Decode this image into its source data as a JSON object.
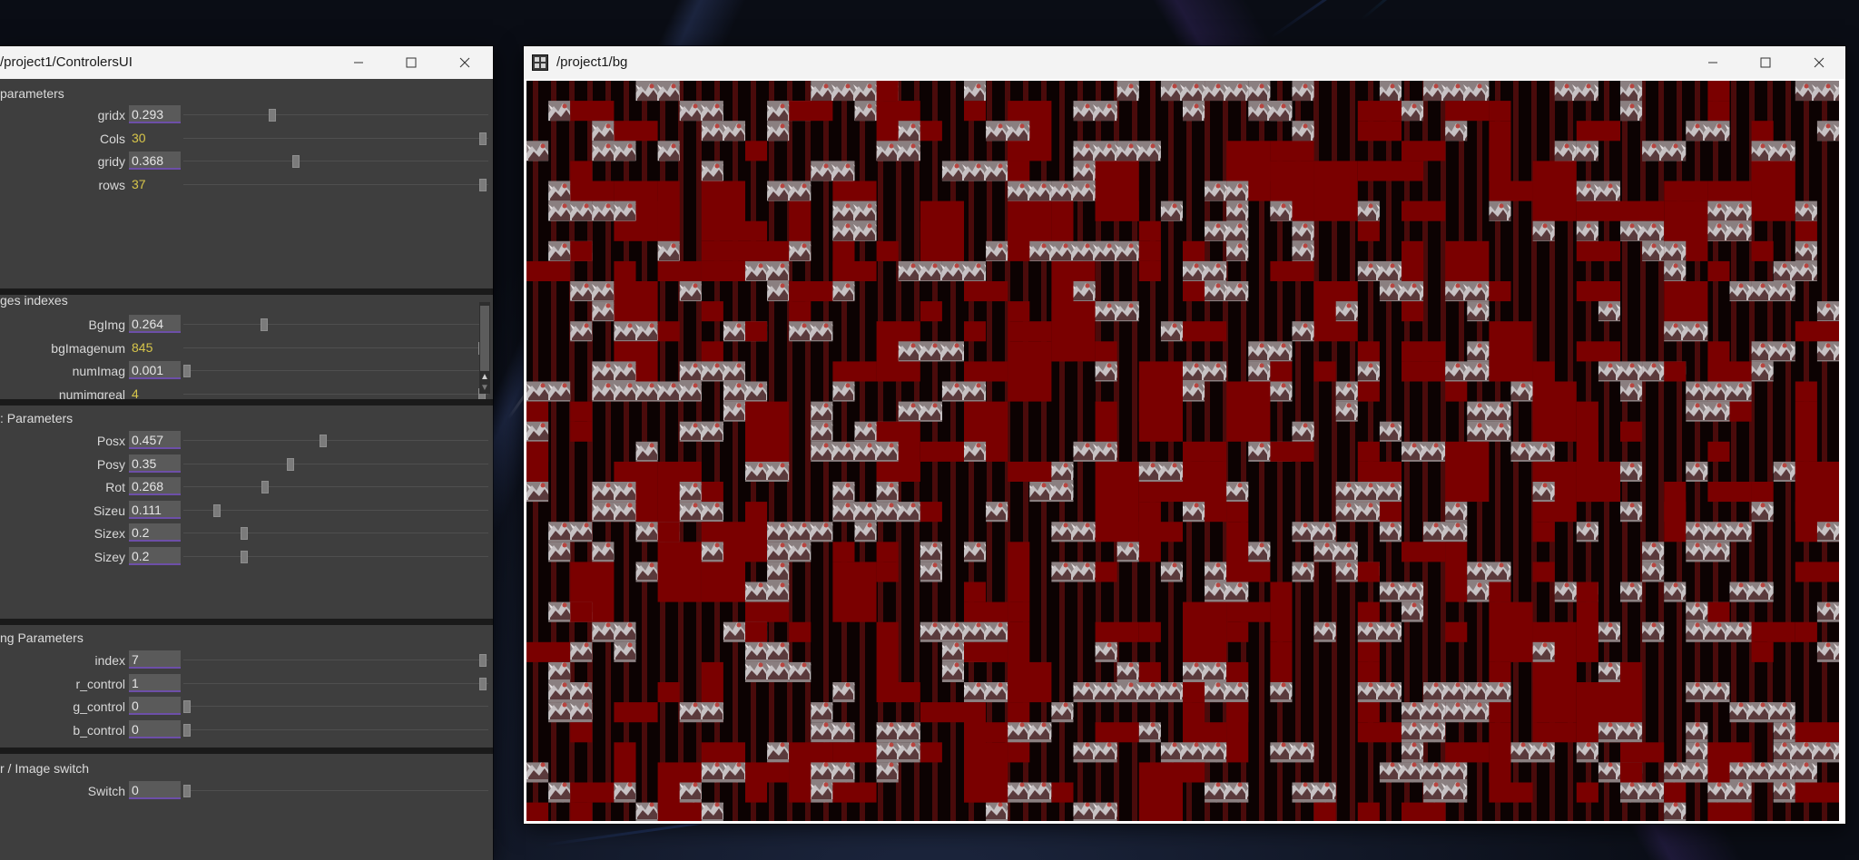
{
  "controllers_window": {
    "title": "/project1/ControlersUI",
    "sections": [
      {
        "title": "parameters",
        "rows": [
          {
            "label": "gridx",
            "value": "0.293",
            "style": "box",
            "level": 0.293
          },
          {
            "label": "Cols",
            "value": "30",
            "style": "yellow",
            "level": 1.0
          },
          {
            "label": "gridy",
            "value": "0.368",
            "style": "box",
            "level": 0.368
          },
          {
            "label": "rows",
            "value": "37",
            "style": "yellow",
            "level": 1.0
          }
        ]
      },
      {
        "title": "ges indexes",
        "rows": [
          {
            "label": "BgImg",
            "value": "0.264",
            "style": "box",
            "level": 0.264
          },
          {
            "label": "bgImagenum",
            "value": "845",
            "style": "yellow",
            "level": 0.98
          },
          {
            "label": "numImag",
            "value": "0.001",
            "style": "box",
            "level": 0.001
          },
          {
            "label": "numimgreal",
            "value": "4",
            "style": "yellow",
            "level": 0.98
          }
        ]
      },
      {
        "title": ": Parameters",
        "rows": [
          {
            "label": "Posx",
            "value": "0.457",
            "style": "box",
            "level": 0.457
          },
          {
            "label": "Posy",
            "value": "0.35",
            "style": "box",
            "level": 0.35
          },
          {
            "label": "Rot",
            "value": "0.268",
            "style": "box",
            "level": 0.268
          },
          {
            "label": "Sizeu",
            "value": "0.111",
            "style": "box",
            "level": 0.111
          },
          {
            "label": "Sizex",
            "value": "0.2",
            "style": "box",
            "level": 0.2
          },
          {
            "label": "Sizey",
            "value": "0.2",
            "style": "box",
            "level": 0.2
          }
        ]
      },
      {
        "title": "ng Parameters",
        "rows": [
          {
            "label": "index",
            "value": "7",
            "style": "box",
            "level": 1.0
          },
          {
            "label": "r_control",
            "value": "1",
            "style": "box",
            "level": 1.0
          },
          {
            "label": "g_control",
            "value": "0",
            "style": "box",
            "level": 0.0
          },
          {
            "label": "b_control",
            "value": "0",
            "style": "box",
            "level": 0.0
          }
        ]
      },
      {
        "title": "r / Image switch",
        "rows": [
          {
            "label": "Switch",
            "value": "0",
            "style": "box",
            "level": 0.0
          }
        ]
      }
    ],
    "scroll_up_arrow": "▲",
    "scroll_down_arrow": "▼"
  },
  "bg_window": {
    "title": "/project1/bg",
    "icon": "touchdesigner-app-icon"
  },
  "window_controls": {
    "minimize_icon": "minimize-icon",
    "maximize_icon": "maximize-icon",
    "close_icon": "close-icon"
  },
  "colors": {
    "dark_red": "#7a0000",
    "stripe_red": "#4a0b0b",
    "slider_value": "#d8c64a",
    "panel_bg": "#3e3e3e"
  }
}
